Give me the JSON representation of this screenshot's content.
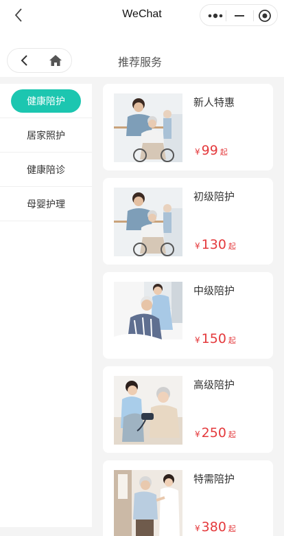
{
  "wechat_bar": {
    "title": "WeChat"
  },
  "header": {
    "title": "推荐服务"
  },
  "categories": [
    {
      "label": "健康陪护",
      "active": true
    },
    {
      "label": "居家照护",
      "active": false
    },
    {
      "label": "健康陪诊",
      "active": false
    },
    {
      "label": "母婴护理",
      "active": false
    }
  ],
  "services": [
    {
      "name": "新人特惠",
      "currency": "¥",
      "price": "99",
      "suffix": "起",
      "image": "caregiver-with-senior-in-wheelchair"
    },
    {
      "name": "初级陪护",
      "currency": "¥",
      "price": "130",
      "suffix": "起",
      "image": "caregiver-with-senior-in-wheelchair"
    },
    {
      "name": "中级陪护",
      "currency": "¥",
      "price": "150",
      "suffix": "起",
      "image": "nurse-with-senior-man"
    },
    {
      "name": "高级陪护",
      "currency": "¥",
      "price": "250",
      "suffix": "起",
      "image": "nurse-measuring-blood-pressure"
    },
    {
      "name": "特需陪护",
      "currency": "¥",
      "price": "380",
      "suffix": "起",
      "image": "nurse-helping-senior-walk"
    }
  ],
  "colors": {
    "accent": "#1cc6b0",
    "price": "#e4393c",
    "background": "#f4f4f4"
  }
}
